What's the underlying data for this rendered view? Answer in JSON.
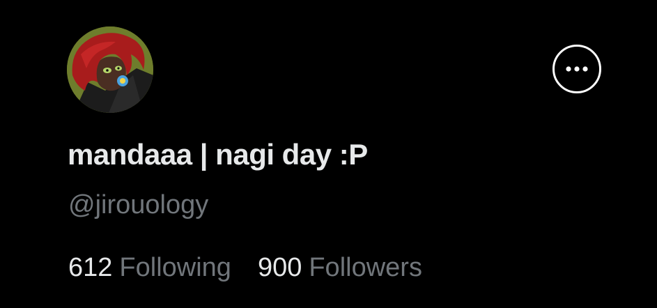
{
  "profile": {
    "display_name": "mandaaa | nagi day :P",
    "handle": "@jirouology",
    "avatar_icon": "profile-avatar",
    "more_icon": "more-options-icon"
  },
  "stats": {
    "following_count": "612",
    "following_label": "Following",
    "followers_count": "900",
    "followers_label": "Followers"
  },
  "colors": {
    "background": "#000000",
    "primary_text": "#e7e9ea",
    "secondary_text": "#71767b",
    "button_border": "#ffffff"
  }
}
